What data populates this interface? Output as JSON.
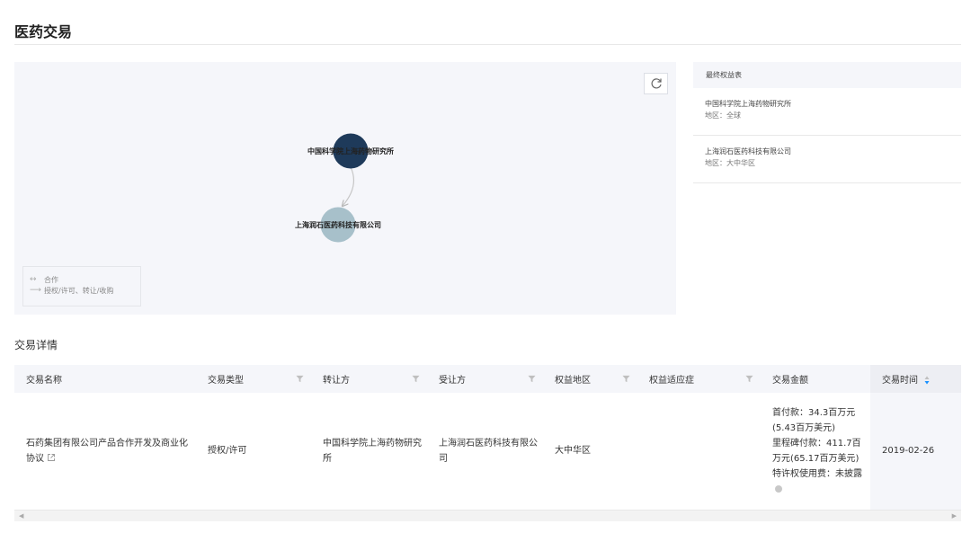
{
  "page": {
    "title": "医药交易"
  },
  "graph": {
    "nodes": [
      {
        "label": "中国科学院上海药物研究所",
        "color": "#1e3a5a"
      },
      {
        "label": "上海润石医药科技有限公司",
        "color": "#a7c0ca"
      }
    ],
    "legend": {
      "items": [
        {
          "symbol": "↔",
          "label": "合作"
        },
        {
          "symbol": "⟶",
          "label": "授权/许可、转让/收购"
        }
      ]
    }
  },
  "rights": {
    "header": "最终权益表",
    "items": [
      {
        "name": "中国科学院上海药物研究所",
        "region": "地区：全球"
      },
      {
        "name": "上海润石医药科技有限公司",
        "region": "地区：大中华区"
      }
    ]
  },
  "section": {
    "title": "交易详情"
  },
  "table": {
    "headers": {
      "name": "交易名称",
      "type": "交易类型",
      "transferor": "转让方",
      "transferee": "受让方",
      "region": "权益地区",
      "indication": "权益适应症",
      "amount": "交易金额",
      "date": "交易时间"
    },
    "rows": [
      {
        "name": "石药集团有限公司产品合作开发及商业化协议",
        "type": "授权/许可",
        "transferor": "中国科学院上海药物研究所",
        "transferee": "上海润石医药科技有限公司",
        "region": "大中华区",
        "indication": "",
        "amount": {
          "upfront": "首付款：34.3百万元(5.43百万美元)",
          "milestone": "里程碑付款：411.7百万元(65.17百万美元)",
          "royalty": "特许权使用费：未披露"
        },
        "date": "2019-02-26"
      }
    ]
  },
  "colors": {
    "panel_bg": "#f5f6fa",
    "node_dark": "#1e3a5a",
    "node_light": "#a7c0ca",
    "sort_accent": "#1890ff"
  }
}
